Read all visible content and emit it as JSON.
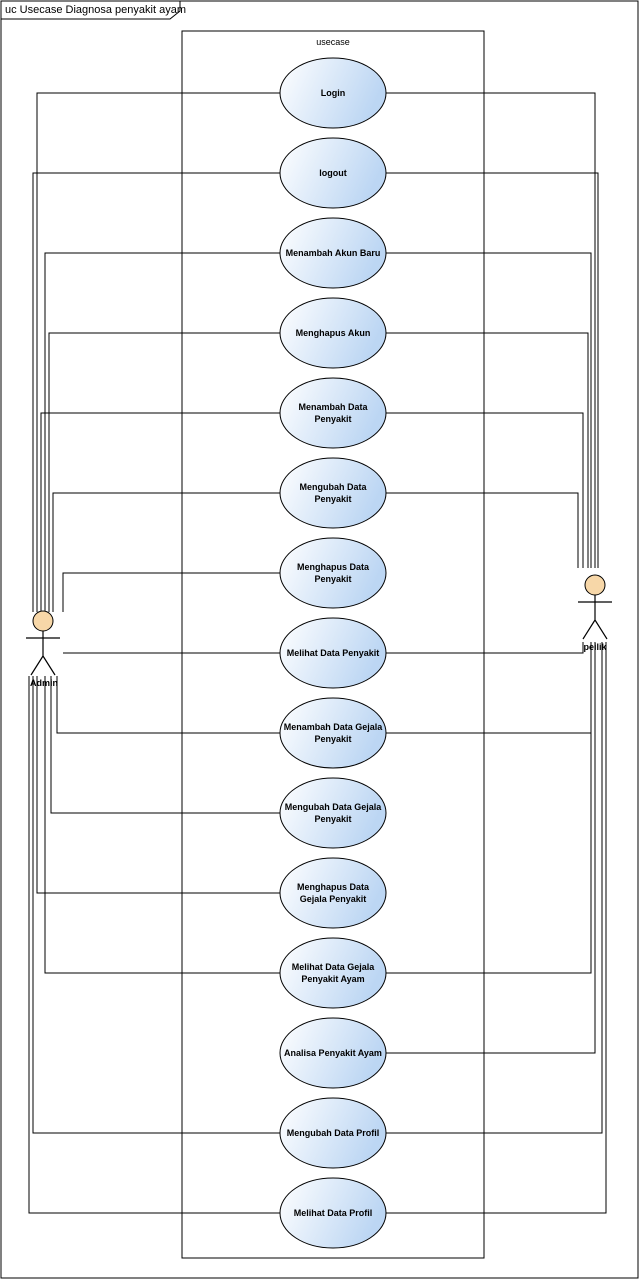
{
  "diagram": {
    "title": "uc Usecase Diagnosa penyakit ayam",
    "boundary_label": "usecase"
  },
  "actors": [
    {
      "id": "admin",
      "label": "Admin"
    },
    {
      "id": "peilik",
      "label": "peilik"
    }
  ],
  "use_cases": [
    {
      "id": "login",
      "lines": [
        "Login"
      ]
    },
    {
      "id": "logout",
      "lines": [
        "logout"
      ]
    },
    {
      "id": "menambah-akun-baru",
      "lines": [
        "Menambah Akun Baru"
      ]
    },
    {
      "id": "menghapus-akun",
      "lines": [
        "Menghapus Akun"
      ]
    },
    {
      "id": "menambah-data-penyakit",
      "lines": [
        "Menambah Data",
        "Penyakit"
      ]
    },
    {
      "id": "mengubah-data-penyakit",
      "lines": [
        "Mengubah Data",
        "Penyakit"
      ]
    },
    {
      "id": "menghapus-data-penyakit",
      "lines": [
        "Menghapus Data",
        "Penyakit"
      ]
    },
    {
      "id": "melihat-data-penyakit",
      "lines": [
        "Melihat Data Penyakit"
      ]
    },
    {
      "id": "menambah-data-gejala-penyakit",
      "lines": [
        "Menambah Data Gejala",
        "Penyakit"
      ]
    },
    {
      "id": "mengubah-data-gejala-penyakit",
      "lines": [
        "Mengubah Data Gejala",
        "Penyakit"
      ]
    },
    {
      "id": "menghapus-data-gejala-penyakit",
      "lines": [
        "Menghapus Data",
        "Gejala Penyakit"
      ]
    },
    {
      "id": "melihat-data-gejala-penyakit-ayam",
      "lines": [
        "Melihat Data Gejala",
        "Penyakit Ayam"
      ]
    },
    {
      "id": "analisa-penyakit-ayam",
      "lines": [
        "Analisa Penyakit Ayam"
      ]
    },
    {
      "id": "mengubah-data-profil",
      "lines": [
        "Mengubah Data Profil"
      ]
    },
    {
      "id": "melihat-data-profil",
      "lines": [
        "Melihat Data Profil"
      ]
    }
  ],
  "associations": {
    "admin": [
      "login",
      "logout",
      "menambah-akun-baru",
      "menghapus-akun",
      "menambah-data-penyakit",
      "mengubah-data-penyakit",
      "menghapus-data-penyakit",
      "melihat-data-penyakit",
      "menambah-data-gejala-penyakit",
      "mengubah-data-gejala-penyakit",
      "menghapus-data-gejala-penyakit",
      "melihat-data-gejala-penyakit-ayam",
      "mengubah-data-profil",
      "melihat-data-profil"
    ],
    "peilik": [
      "login",
      "logout",
      "menambah-akun-baru",
      "menghapus-akun",
      "menambah-data-penyakit",
      "mengubah-data-penyakit",
      "melihat-data-penyakit",
      "menambah-data-gejala-penyakit",
      "melihat-data-gejala-penyakit-ayam",
      "analisa-penyakit-ayam",
      "mengubah-data-profil",
      "melihat-data-profil"
    ]
  },
  "colors": {
    "usecase_fill_light": "#ffffff",
    "usecase_fill_dark": "#bcd6f3",
    "actor_head": "#f7d7a8",
    "line": "#000000"
  }
}
